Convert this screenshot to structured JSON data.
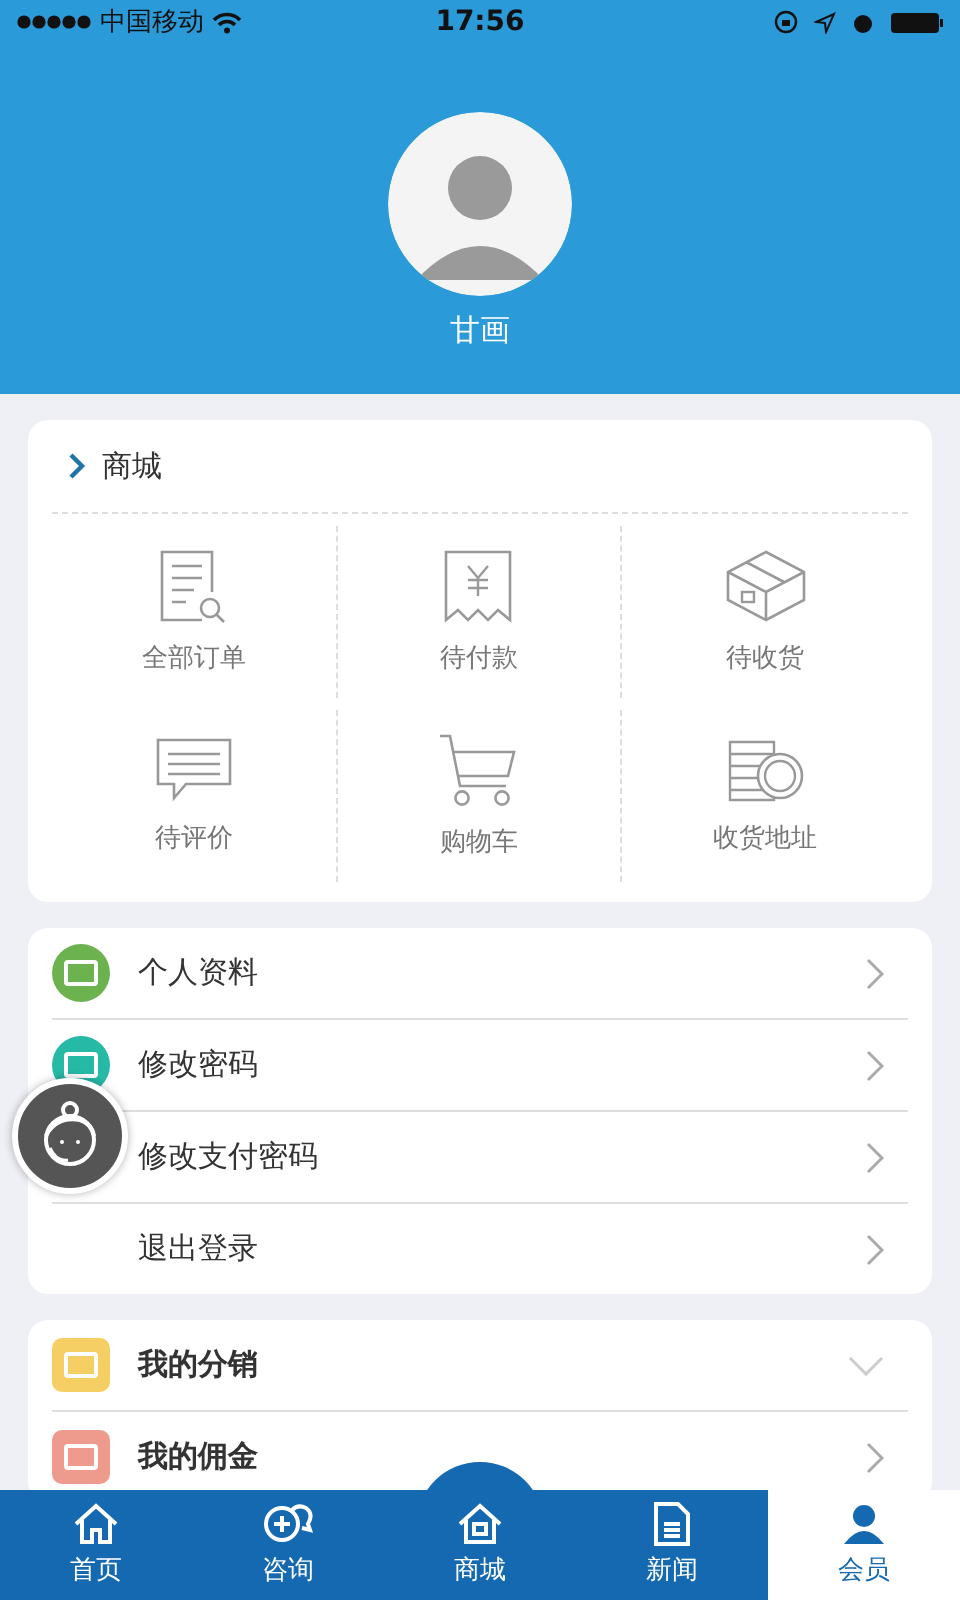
{
  "status_bar": {
    "carrier": "中国移动",
    "time": "17:56"
  },
  "profile": {
    "name": "甘画"
  },
  "shop": {
    "title": "商城",
    "items": [
      {
        "label": "全部订单",
        "kind": "orders"
      },
      {
        "label": "待付款",
        "kind": "payment"
      },
      {
        "label": "待收货",
        "kind": "box"
      },
      {
        "label": "待评价",
        "kind": "comment"
      },
      {
        "label": "购物车",
        "kind": "cart"
      },
      {
        "label": "收货地址",
        "kind": "coins"
      }
    ]
  },
  "account_menu": [
    {
      "label": "个人资料",
      "color": "#6cb34f",
      "kind": "link"
    },
    {
      "label": "修改密码",
      "color": "#26b9a6",
      "kind": "link"
    },
    {
      "label": "修改支付密码",
      "kind": "link"
    },
    {
      "label": "退出登录",
      "kind": "link"
    }
  ],
  "distribution_menu": [
    {
      "label": "我的分销",
      "color": "#f5cf63",
      "kind": "toggle"
    },
    {
      "label": "我的佣金",
      "color": "#ee9a8c",
      "kind": "link"
    }
  ],
  "tab_bar": [
    {
      "label": "首页",
      "kind": "home",
      "selected": false,
      "raised": false
    },
    {
      "label": "咨询",
      "kind": "chat",
      "selected": false,
      "raised": false
    },
    {
      "label": "商城",
      "kind": "shop",
      "selected": false,
      "raised": true
    },
    {
      "label": "新闻",
      "kind": "news",
      "selected": false,
      "raised": false
    },
    {
      "label": "会员",
      "kind": "member",
      "selected": true,
      "raised": false
    }
  ]
}
